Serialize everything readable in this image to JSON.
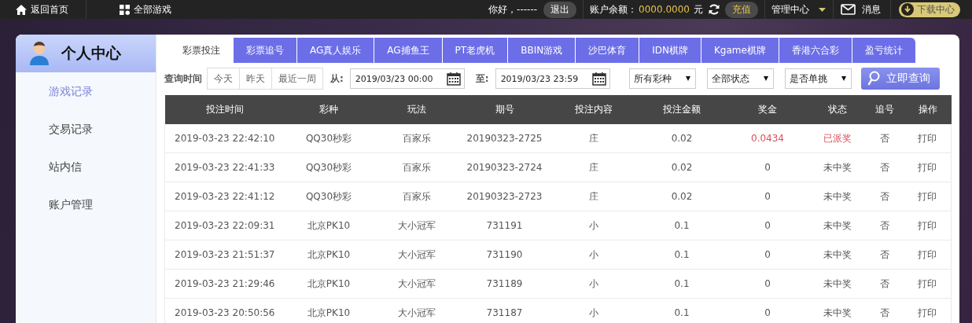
{
  "top_bar": {
    "home": "返回首页",
    "all_games": "全部游戏",
    "greeting": "你好，------",
    "logout": "退出",
    "balance_label": "账户余额：",
    "balance": "0000.0000",
    "currency": "元",
    "recharge": "充值",
    "manage": "管理中心",
    "messages": "消息",
    "download": "下载中心"
  },
  "sidebar": {
    "title": "个人中心",
    "items": [
      {
        "label": "游戏记录",
        "selected": true
      },
      {
        "label": "交易记录",
        "selected": false
      },
      {
        "label": "站内信",
        "selected": false
      },
      {
        "label": "账户管理",
        "selected": false
      }
    ]
  },
  "tabs": [
    {
      "label": "彩票投注",
      "selected": true
    },
    {
      "label": "彩票追号",
      "selected": false
    },
    {
      "label": "AG真人娱乐",
      "selected": false
    },
    {
      "label": "AG捕鱼王",
      "selected": false
    },
    {
      "label": "PT老虎机",
      "selected": false
    },
    {
      "label": "BBIN游戏",
      "selected": false
    },
    {
      "label": "沙巴体育",
      "selected": false
    },
    {
      "label": "IDN棋牌",
      "selected": false
    },
    {
      "label": "Kgame棋牌",
      "selected": false
    },
    {
      "label": "香港六合彩",
      "selected": false
    },
    {
      "label": "盈亏统计",
      "selected": false
    }
  ],
  "filters": {
    "label": "查询时间",
    "quick": [
      "今天",
      "昨天",
      "最近一周"
    ],
    "from_label": "从:",
    "from": "2019/03/23 00:00",
    "to_label": "至:",
    "to": "2019/03/23 23:59",
    "selects": [
      "所有彩种",
      "全部状态",
      "是否单挑"
    ],
    "search": "立即查询"
  },
  "table": {
    "columns": [
      "投注时间",
      "彩种",
      "玩法",
      "期号",
      "投注内容",
      "投注金额",
      "奖金",
      "状态",
      "追号",
      "操作"
    ],
    "rows": [
      {
        "won": true,
        "cells": [
          "2019-03-23 22:42:10",
          "QQ30秒彩",
          "百家乐",
          "20190323-2725",
          "庄",
          "0.02",
          "0.0434",
          "已派奖",
          "否",
          "打印"
        ]
      },
      {
        "won": false,
        "cells": [
          "2019-03-23 22:41:33",
          "QQ30秒彩",
          "百家乐",
          "20190323-2724",
          "庄",
          "0.02",
          "0",
          "未中奖",
          "否",
          "打印"
        ]
      },
      {
        "won": false,
        "cells": [
          "2019-03-23 22:41:12",
          "QQ30秒彩",
          "百家乐",
          "20190323-2723",
          "庄",
          "0.02",
          "0",
          "未中奖",
          "否",
          "打印"
        ]
      },
      {
        "won": false,
        "cells": [
          "2019-03-23 22:09:31",
          "北京PK10",
          "大小冠军",
          "731191",
          "小",
          "0.1",
          "0",
          "未中奖",
          "否",
          "打印"
        ]
      },
      {
        "won": false,
        "cells": [
          "2019-03-23 21:51:37",
          "北京PK10",
          "大小冠军",
          "731190",
          "小",
          "0.1",
          "0",
          "未中奖",
          "否",
          "打印"
        ]
      },
      {
        "won": false,
        "cells": [
          "2019-03-23 21:29:46",
          "北京PK10",
          "大小冠军",
          "731189",
          "小",
          "0.1",
          "0",
          "未中奖",
          "否",
          "打印"
        ]
      },
      {
        "won": false,
        "cells": [
          "2019-03-23 20:50:56",
          "北京PK10",
          "大小冠军",
          "731187",
          "小",
          "0.1",
          "0",
          "未中奖",
          "否",
          "打印"
        ]
      }
    ]
  }
}
